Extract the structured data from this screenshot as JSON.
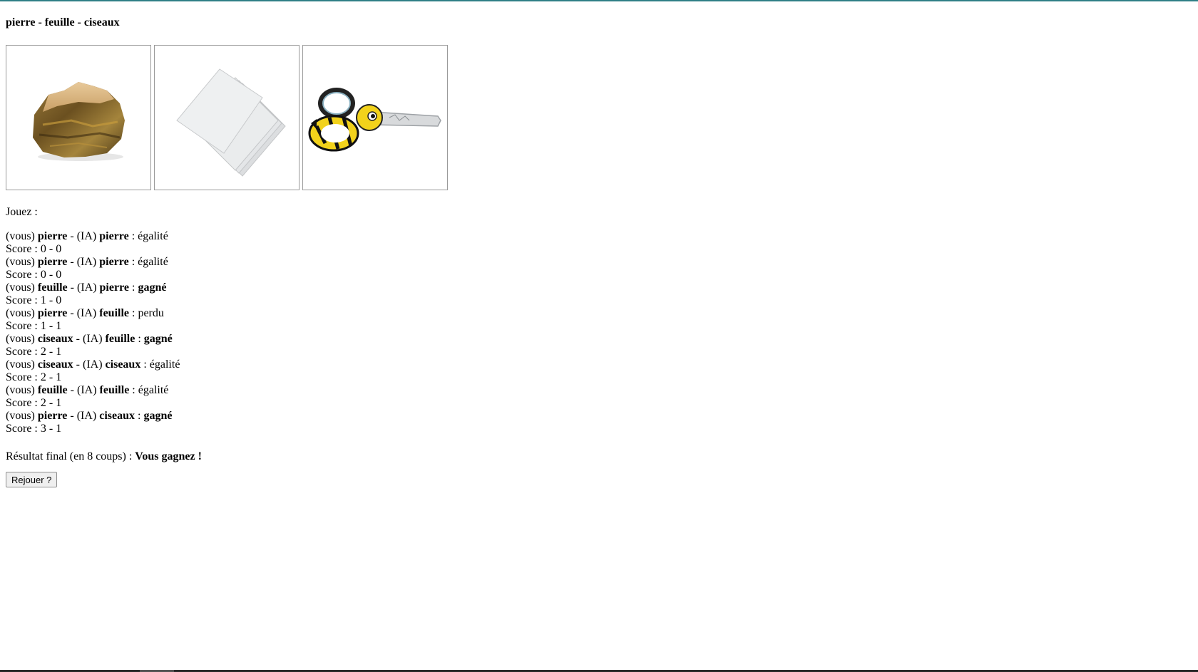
{
  "title": "pierre - feuille - ciseaux",
  "choices": [
    {
      "name": "pierre",
      "icon": "rock-image"
    },
    {
      "name": "feuille",
      "icon": "paper-image"
    },
    {
      "name": "ciseaux",
      "icon": "scissors-image"
    }
  ],
  "prompt": "Jouez :",
  "rounds": [
    {
      "you_prefix": "(vous) ",
      "you": "pierre",
      "mid": " - (IA) ",
      "ai": "pierre",
      "sep": " : ",
      "result": "égalité",
      "result_bold": false,
      "score": "Score : 0 - 0"
    },
    {
      "you_prefix": "(vous) ",
      "you": "pierre",
      "mid": " - (IA) ",
      "ai": "pierre",
      "sep": " : ",
      "result": "égalité",
      "result_bold": false,
      "score": "Score : 0 - 0"
    },
    {
      "you_prefix": "(vous) ",
      "you": "feuille",
      "mid": " - (IA) ",
      "ai": "pierre",
      "sep": " : ",
      "result": "gagné",
      "result_bold": true,
      "score": "Score : 1 - 0"
    },
    {
      "you_prefix": "(vous) ",
      "you": "pierre",
      "mid": " - (IA) ",
      "ai": "feuille",
      "sep": " : ",
      "result": "perdu",
      "result_bold": false,
      "score": "Score : 1 - 1"
    },
    {
      "you_prefix": "(vous) ",
      "you": "ciseaux",
      "mid": " - (IA) ",
      "ai": "feuille",
      "sep": " : ",
      "result": "gagné",
      "result_bold": true,
      "score": "Score : 2 - 1"
    },
    {
      "you_prefix": "(vous) ",
      "you": "ciseaux",
      "mid": " - (IA) ",
      "ai": "ciseaux",
      "sep": " : ",
      "result": "égalité",
      "result_bold": false,
      "score": "Score : 2 - 1"
    },
    {
      "you_prefix": "(vous) ",
      "you": "feuille",
      "mid": " - (IA) ",
      "ai": "feuille",
      "sep": " : ",
      "result": "égalité",
      "result_bold": false,
      "score": "Score : 2 - 1"
    },
    {
      "you_prefix": "(vous) ",
      "you": "pierre",
      "mid": " - (IA) ",
      "ai": "ciseaux",
      "sep": " : ",
      "result": "gagné",
      "result_bold": true,
      "score": "Score : 3 - 1"
    }
  ],
  "final": {
    "label": "Résultat final (en 8 coups) : ",
    "value": "Vous gagnez !"
  },
  "replay_label": "Rejouer ?",
  "colors": {
    "top_accent": "#2f7f86",
    "bee_yellow": "#f2d21b",
    "rock_brown": "#8a6a2e"
  }
}
